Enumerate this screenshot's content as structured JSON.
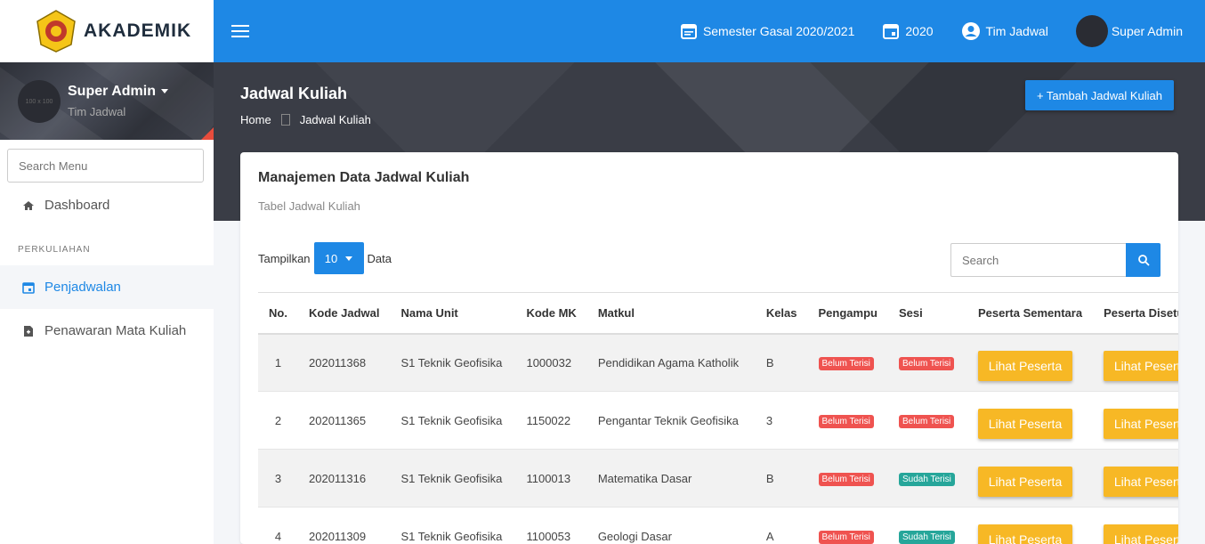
{
  "brand": {
    "name": "AKADEMIK"
  },
  "user": {
    "name": "Super Admin",
    "role": "Tim Jadwal",
    "avatar_text": "100 x 100"
  },
  "sidebar": {
    "search_placeholder": "Search Menu",
    "items": [
      {
        "label": "Dashboard",
        "icon": "home-icon"
      },
      {
        "label": "Penjadwalan",
        "icon": "calendar-icon",
        "active": true
      },
      {
        "label": "Penawaran Mata Kuliah",
        "icon": "document-icon"
      }
    ],
    "section_header": "PERKULIAHAN"
  },
  "topbar": {
    "semester": "Semester Gasal 2020/2021",
    "year": "2020",
    "team": "Tim Jadwal",
    "user": "Super Admin"
  },
  "header": {
    "title": "Jadwal Kuliah",
    "breadcrumb_home": "Home",
    "breadcrumb_current": "Jadwal Kuliah",
    "add_button": "+ Tambah Jadwal Kuliah"
  },
  "card": {
    "title": "Manajemen Data Jadwal Kuliah",
    "subtitle": "Tabel Jadwal Kuliah",
    "show_label": "Tampilkan",
    "show_value": "10",
    "show_suffix": "Data",
    "search_placeholder": "Search"
  },
  "table": {
    "columns": [
      "No.",
      "Kode Jadwal",
      "Nama Unit",
      "Kode MK",
      "Matkul",
      "Kelas",
      "Pengampu",
      "Sesi",
      "Peserta Sementara",
      "Peserta Disetujui"
    ],
    "rows": [
      {
        "no": "1",
        "kode": "202011368",
        "unit": "S1 Teknik Geofisika",
        "mk": "1000032",
        "matkul": "Pendidikan Agama Katholik",
        "kelas": "B",
        "pengampu": "Belum Terisi",
        "sesi": "Belum Terisi",
        "sesi_status": "red",
        "btn1": "Lihat Peserta",
        "btn2": "Lihat Peserta"
      },
      {
        "no": "2",
        "kode": "202011365",
        "unit": "S1 Teknik Geofisika",
        "mk": "1150022",
        "matkul": "Pengantar Teknik Geofisika",
        "kelas": "3",
        "pengampu": "Belum Terisi",
        "sesi": "Belum Terisi",
        "sesi_status": "red",
        "btn1": "Lihat Peserta",
        "btn2": "Lihat Peserta"
      },
      {
        "no": "3",
        "kode": "202011316",
        "unit": "S1 Teknik Geofisika",
        "mk": "1100013",
        "matkul": "Matematika Dasar",
        "kelas": "B",
        "pengampu": "Belum Terisi",
        "sesi": "Sudah Terisi",
        "sesi_status": "green",
        "btn1": "Lihat Peserta",
        "btn2": "Lihat Peserta"
      },
      {
        "no": "4",
        "kode": "202011309",
        "unit": "S1 Teknik Geofisika",
        "mk": "1100053",
        "matkul": "Geologi Dasar",
        "kelas": "A",
        "pengampu": "Belum Terisi",
        "sesi": "Sudah Terisi",
        "sesi_status": "green",
        "btn1": "Lihat Peserta",
        "btn2": "Lihat Peserta"
      }
    ]
  },
  "colors": {
    "primary": "#1e88e5",
    "warning": "#f7b825",
    "danger": "#ef5350",
    "success": "#26a69a"
  }
}
